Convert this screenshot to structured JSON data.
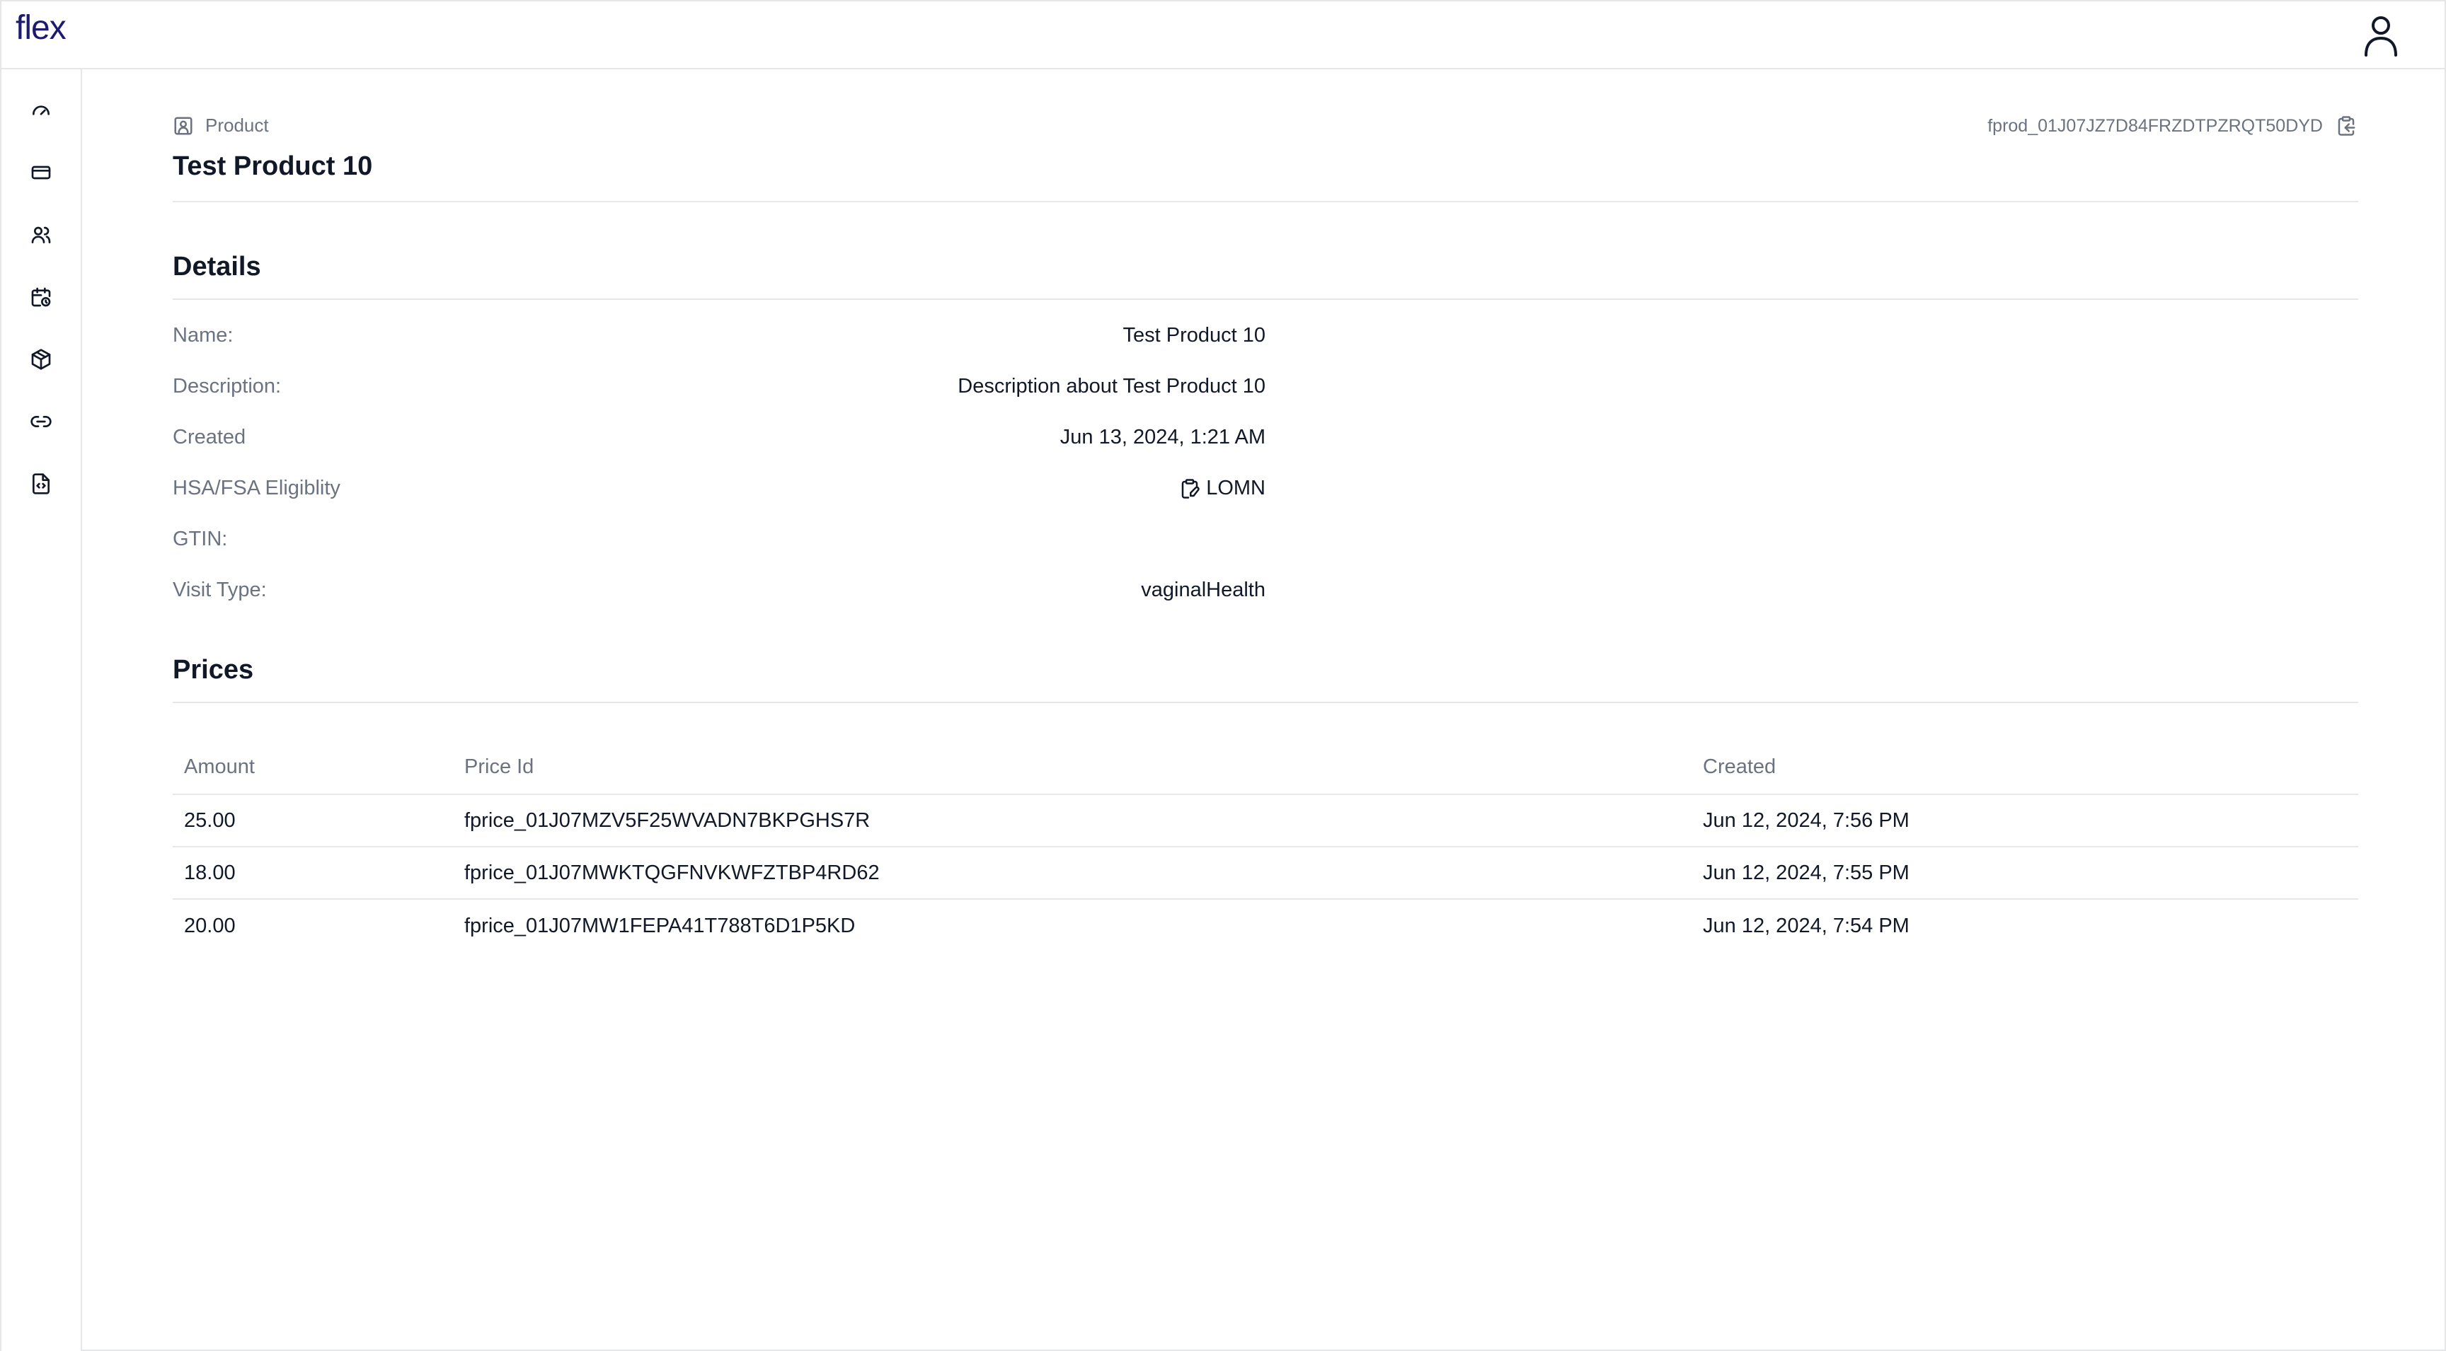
{
  "app": {
    "logo": "flex"
  },
  "sidebar": {
    "items": [
      {
        "name": "dashboard",
        "icon": "gauge-icon"
      },
      {
        "name": "payments",
        "icon": "credit-card-icon"
      },
      {
        "name": "customers",
        "icon": "users-icon"
      },
      {
        "name": "subscriptions",
        "icon": "calendar-clock-icon"
      },
      {
        "name": "products",
        "icon": "package-icon"
      },
      {
        "name": "links",
        "icon": "link-icon"
      },
      {
        "name": "documents",
        "icon": "file-code-icon"
      }
    ]
  },
  "header": {
    "crumb": "Product",
    "product_id": "fprod_01J07JZ7D84FRZDTPZRQT50DYD",
    "title": "Test Product 10"
  },
  "details": {
    "title": "Details",
    "rows": [
      {
        "label": "Name:",
        "value": "Test Product 10"
      },
      {
        "label": "Description:",
        "value": "Description about Test Product 10"
      },
      {
        "label": "Created",
        "value": "Jun 13, 2024, 1:21 AM"
      },
      {
        "label": "HSA/FSA Eligiblity",
        "value": "LOMN"
      },
      {
        "label": "GTIN:",
        "value": ""
      },
      {
        "label": "Visit Type:",
        "value": "vaginalHealth"
      }
    ]
  },
  "prices": {
    "title": "Prices",
    "columns": [
      "Amount",
      "Price Id",
      "Created"
    ],
    "rows": [
      {
        "amount": "25.00",
        "price_id": "fprice_01J07MZV5F25WVADN7BKPGHS7R",
        "created": "Jun 12, 2024, 7:56 PM"
      },
      {
        "amount": "18.00",
        "price_id": "fprice_01J07MWKTQGFNVKWFZTBP4RD62",
        "created": "Jun 12, 2024, 7:55 PM"
      },
      {
        "amount": "20.00",
        "price_id": "fprice_01J07MW1FEPA41T788T6D1P5KD",
        "created": "Jun 12, 2024, 7:54 PM"
      }
    ]
  },
  "colors": {
    "brand": "#1e1b6e",
    "border": "#e5e7eb",
    "muted_text": "#6b7280",
    "text": "#111827"
  }
}
